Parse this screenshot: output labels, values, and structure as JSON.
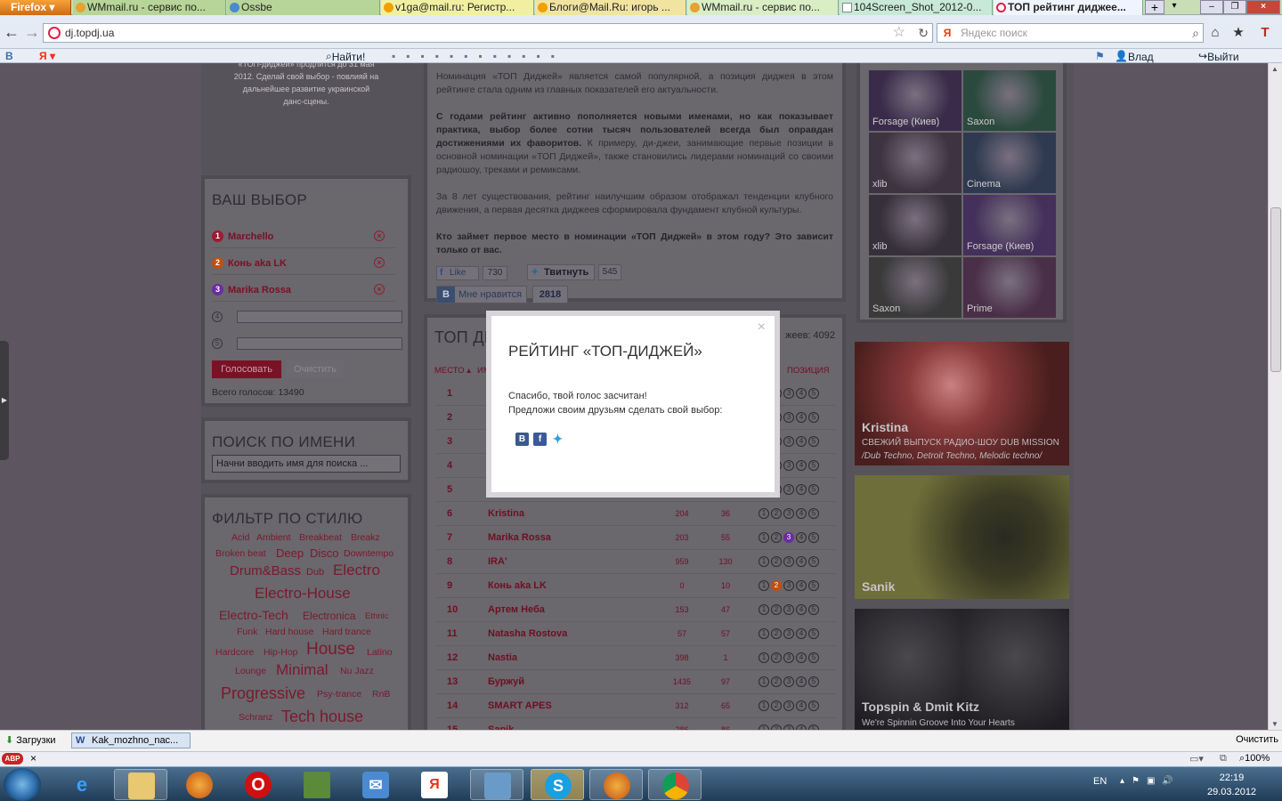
{
  "browser": {
    "firefox_label": "Firefox",
    "tabs": [
      {
        "title": "WMmail.ru - сервис по...",
        "active": false
      },
      {
        "title": "Ossbe",
        "active": false
      },
      {
        "title": "v1ga@mail.ru: Регистр...",
        "active": false
      },
      {
        "title": "Блоги@Mail.Ru: игорь ...",
        "active": false
      },
      {
        "title": "WMmail.ru - сервис по...",
        "active": false
      },
      {
        "title": "104Screen_Shot_2012-0...",
        "active": false
      },
      {
        "title": "ТОП рейтинг диджее...",
        "active": true
      }
    ],
    "url": "dj.topdj.ua",
    "search_placeholder": "Яндекс поиск",
    "bookmarks": {
      "find_label": "Найти!",
      "user_name": "Влад Дитлов",
      "logout_label": "Выйти"
    }
  },
  "site": {
    "intro_text_lines": [
      "«ТОП-диджей» продлится до 31 мая",
      "2012. Сделай свой выбор - повлияй на",
      "дальнейшее развитие украинской",
      "данс-сцены."
    ],
    "article": {
      "p1": "Номинация «ТОП Диджей» является самой популярной, а позиция диджея в этом рейтинге стала одним из главных показателей его актуальности.",
      "p2_bold": "С годами рейтинг активно пополняется новыми именами, но как показывает практика, выбор более сотни тысяч пользователей всегда был оправдан достижениями их фаворитов.",
      "p2_rest": " К примеру, ди-джеи, занимающие первые позиции в основной номинации «ТОП Диджей», также становились лидерами номинаций со своими радиошоу, треками и ремиксами.",
      "p3": "За 8 лет существования, рейтинг наилучшим образом отображал тенденции клубного движения, а первая десятка диджеев сформировала фундамент клубной культуры.",
      "p4": "Кто займет первое место в номинации «ТОП Диджей» в этом году? Это зависит только от вас."
    },
    "social": {
      "fb_like": "Like",
      "fb_count": "730",
      "tw_label": "Твитнуть",
      "tw_count": "545",
      "vk_label": "Мне нравится",
      "vk_count": "2818"
    },
    "your_choice": {
      "title": "ВАШ ВЫБОР",
      "items": [
        {
          "num": "1",
          "name": "Marchello",
          "color": "#9b1c33"
        },
        {
          "num": "2",
          "name": "Конь aka LK",
          "color": "#c05010"
        },
        {
          "num": "3",
          "name": "Marika Rossa",
          "color": "#6a2da0"
        }
      ],
      "empty_slots": [
        "4",
        "5"
      ],
      "vote_button": "Голосовать",
      "clear_button": "Очистить",
      "total_votes": "Всего голосов: 13490"
    },
    "search_by_name": {
      "title": "ПОИСК ПО ИМЕНИ",
      "placeholder": "Начни вводить имя для поиска ..."
    },
    "style_filter": {
      "title": "ФИЛЬТР ПО СТИЛЮ",
      "tags": [
        "Acid",
        "Ambient",
        "Breakbeat",
        "Breakz",
        "Broken beat",
        "Deep",
        "Disco",
        "Downtempo",
        "Drum&Bass",
        "Dub",
        "Electro",
        "Electro-House",
        "Electro-Tech",
        "Electronica",
        "Ethnic",
        "Funk",
        "Hard house",
        "Hard trance",
        "Hardcore",
        "Hip-Hop",
        "House",
        "Latino",
        "Lounge",
        "Minimal",
        "Nu Jazz",
        "Progressive",
        "Psy-trance",
        "RnB",
        "Schranz",
        "Tech house"
      ]
    },
    "top_table": {
      "title": "ТОП ДИ",
      "count_label": "жеев: 4092",
      "col_place": "МЕСТО",
      "col_name": "ИМ",
      "col_position": "ПОЗИЦИЯ",
      "rows": [
        {
          "place": "1",
          "name": "",
          "c1": "",
          "c2": "",
          "sel": 0
        },
        {
          "place": "2",
          "name": "",
          "c1": "",
          "c2": "",
          "sel": 0
        },
        {
          "place": "3",
          "name": "",
          "c1": "",
          "c2": "",
          "sel": 0
        },
        {
          "place": "4",
          "name": "",
          "c1": "",
          "c2": "",
          "sel": 0
        },
        {
          "place": "5",
          "name": "",
          "c1": "",
          "c2": "",
          "sel": 0
        },
        {
          "place": "6",
          "name": "Kristina",
          "c1": "204",
          "c2": "36",
          "sel": 0
        },
        {
          "place": "7",
          "name": "Marika Rossa",
          "c1": "203",
          "c2": "55",
          "sel": 3
        },
        {
          "place": "8",
          "name": "IRA'",
          "c1": "959",
          "c2": "130",
          "sel": 0
        },
        {
          "place": "9",
          "name": "Конь aka LK",
          "c1": "0",
          "c2": "10",
          "sel": 2
        },
        {
          "place": "10",
          "name": "Артем Неба",
          "c1": "153",
          "c2": "47",
          "sel": 0
        },
        {
          "place": "11",
          "name": "Natasha Rostova",
          "c1": "57",
          "c2": "57",
          "sel": 0
        },
        {
          "place": "12",
          "name": "Nastia",
          "c1": "398",
          "c2": "1",
          "sel": 0
        },
        {
          "place": "13",
          "name": "Буржуй",
          "c1": "1435",
          "c2": "97",
          "sel": 0
        },
        {
          "place": "14",
          "name": "SMART APES",
          "c1": "312",
          "c2": "65",
          "sel": 0
        },
        {
          "place": "15",
          "name": "Sanik",
          "c1": "286",
          "c2": "86",
          "sel": 0
        }
      ]
    },
    "photos": [
      {
        "label": "Forsage (Киев)",
        "bg": "#3a2b4a"
      },
      {
        "label": "Saxon",
        "bg": "#2b4a3e"
      },
      {
        "label": "xlib",
        "bg": "#3e3340"
      },
      {
        "label": "Cinema",
        "bg": "#2f3a50"
      },
      {
        "label": "xlib",
        "bg": "#35303a"
      },
      {
        "label": "Forsage (Киев)",
        "bg": "#44305a"
      },
      {
        "label": "Saxon",
        "bg": "#3a3a3a"
      },
      {
        "label": "Prime",
        "bg": "#4a2f48"
      }
    ],
    "banners": [
      {
        "name": "Kristina",
        "sub": "СВЕЖИЙ ВЫПУСК РАДИО-ШОУ DUB MISSION",
        "sub2": "/Dub Techno, Detroit Techno, Melodic techno/",
        "bg": "#5e2a2a"
      },
      {
        "name": "Sanik",
        "sub": "",
        "sub2": "",
        "bg": "#5a5a2e"
      },
      {
        "name": "Topspin & Dmit Kitz",
        "sub": "We're Spinnin Groove Into Your Hearts",
        "sub2": "",
        "bg": "#232125"
      }
    ]
  },
  "modal": {
    "title": "РЕЙТИНГ «ТОП-ДИДЖЕЙ»",
    "close": "×",
    "line1": "Спасибо, твой голос засчитан!",
    "line2": "Предложи своим друзьям сделать свой выбор:"
  },
  "statusbar": {
    "downloads": "Загрузки",
    "doc": "Kak_mozhno_nac...",
    "clear": "Очистить",
    "zoom": "100%"
  },
  "taskbar": {
    "lang": "EN",
    "time": "22:19",
    "date": "29.03.2012"
  }
}
